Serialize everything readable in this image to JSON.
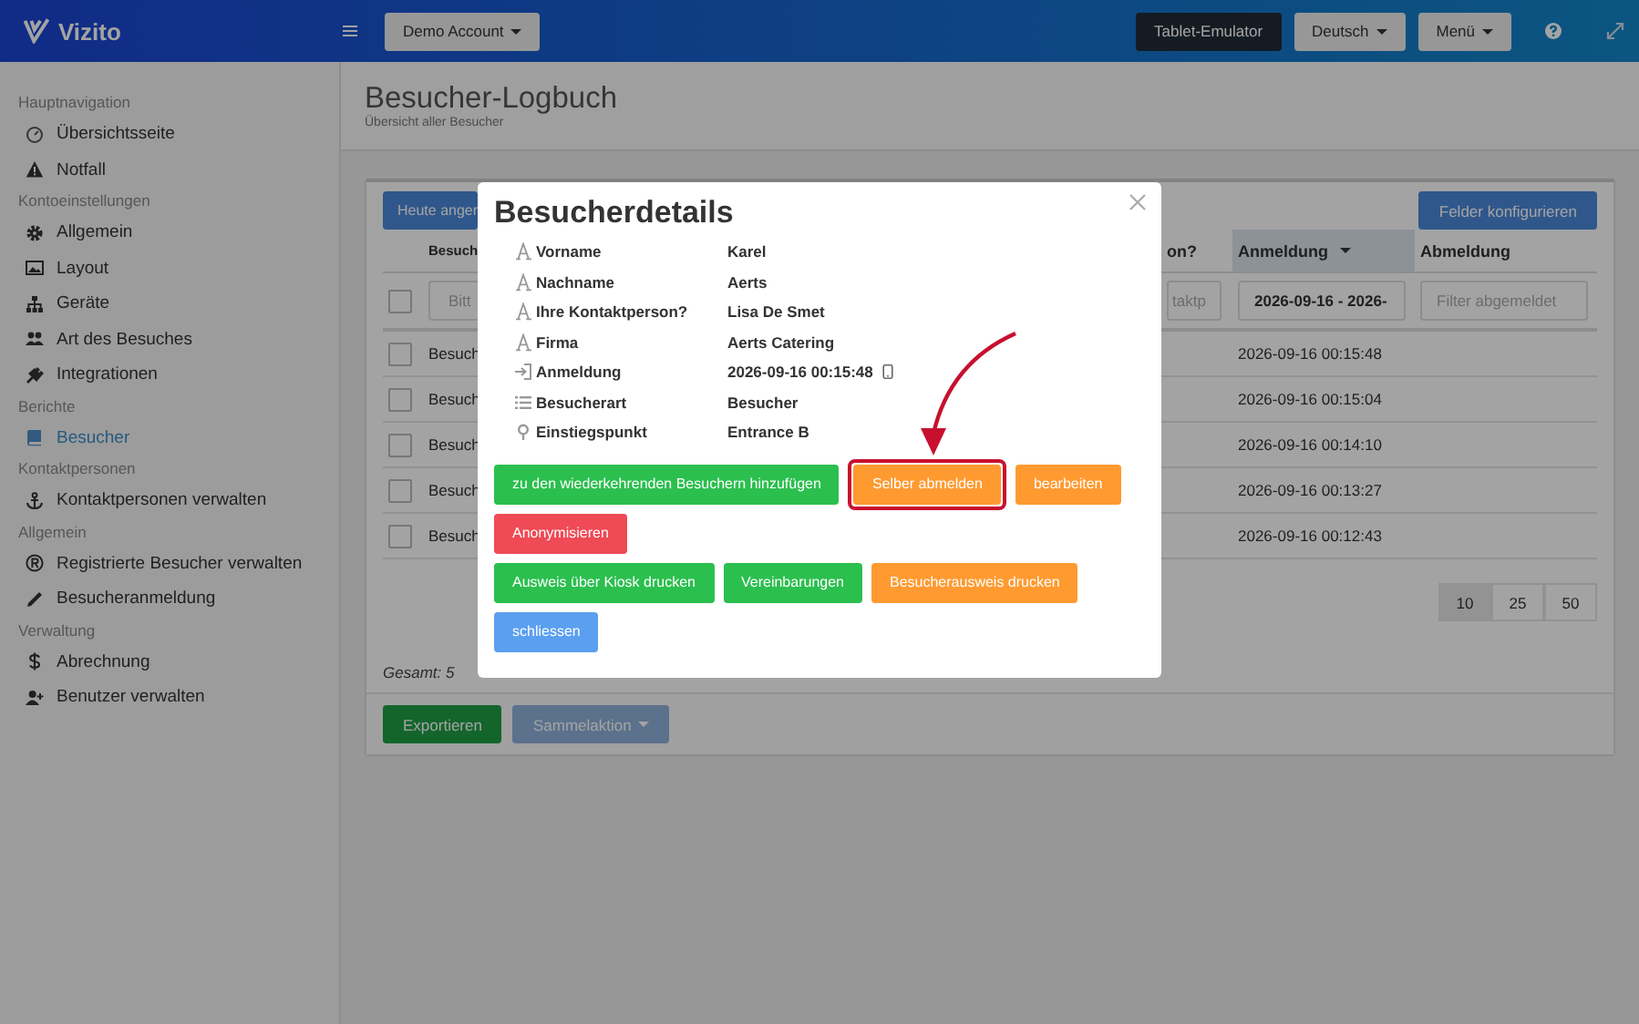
{
  "header": {
    "logo": "Vizito",
    "account": "Demo Account",
    "buttons": [
      {
        "label": "Tablet-Emulator",
        "kind": "dark"
      },
      {
        "label": "Deutsch",
        "kind": "dropdown"
      },
      {
        "label": "Menü",
        "kind": "dropdown"
      }
    ]
  },
  "sidebar": {
    "sections": [
      {
        "title": "Hauptnavigation",
        "items": [
          {
            "label": "Übersichtsseite",
            "selected": false
          },
          {
            "label": "Notfall",
            "selected": false
          }
        ]
      },
      {
        "title": "Kontoeinstellungen",
        "items": [
          {
            "label": "Allgemein",
            "selected": false
          },
          {
            "label": "Layout",
            "selected": false
          },
          {
            "label": "Geräte",
            "selected": false
          },
          {
            "label": "Art des Besuches",
            "selected": false
          },
          {
            "label": "Integrationen",
            "selected": false
          }
        ]
      },
      {
        "title": "Berichte",
        "items": [
          {
            "label": "Besucher",
            "selected": true
          }
        ]
      },
      {
        "title": "Kontaktpersonen",
        "items": [
          {
            "label": "Kontaktpersonen verwalten",
            "selected": false
          }
        ]
      },
      {
        "title": "Allgemein",
        "items": [
          {
            "label": "Registrierte Besucher verwalten",
            "selected": false
          },
          {
            "label": "Besucheranmeldung",
            "selected": false
          }
        ]
      },
      {
        "title": "Verwaltung",
        "items": [
          {
            "label": "Abrechnung",
            "selected": false
          },
          {
            "label": "Benutzer verwalten",
            "selected": false
          }
        ]
      }
    ]
  },
  "page": {
    "title": "Besucher-Logbuch",
    "subtitle": "Übersicht aller Besucher"
  },
  "table_panel": {
    "today_button": "Heute anger",
    "configure_button": "Felder konfigurieren",
    "columns": [
      {
        "label": "Besuch",
        "sorted": false
      },
      {
        "label": "on?",
        "sorted": false
      },
      {
        "label": "Anmeldung",
        "sorted": true
      },
      {
        "label": "Abmeldung",
        "sorted": false
      }
    ],
    "select_all_checked": false,
    "filters": [
      {
        "placeholder": "Bitt"
      },
      {
        "placeholder": "taktp"
      },
      {
        "value": "2026-09-16 - 2026-"
      },
      {
        "placeholder": "Filter abgemeldet"
      }
    ],
    "rows": [
      {
        "checked": false,
        "column_1": "Besuch",
        "anmeldung": "2026-09-16 00:15:48"
      },
      {
        "checked": false,
        "column_1": "Besuch",
        "anmeldung": "2026-09-16 00:15:04"
      },
      {
        "checked": false,
        "column_1": "Besuch",
        "anmeldung": "2026-09-16 00:14:10"
      },
      {
        "checked": false,
        "column_1": "Besuch",
        "anmeldung": "2026-09-16 00:13:27"
      },
      {
        "checked": false,
        "column_1": "Besuch",
        "anmeldung": "2026-09-16 00:12:43"
      }
    ],
    "page_sizes": [
      {
        "label": "10",
        "selected": true
      },
      {
        "label": "25",
        "selected": false
      },
      {
        "label": "50",
        "selected": false
      }
    ],
    "total": "Gesamt: 5",
    "export_button": "Exportieren",
    "bulk_button": "Sammelaktion"
  },
  "modal": {
    "title": "Besucherdetails",
    "details": [
      {
        "kind": "text",
        "label": "Vorname",
        "value": "Karel"
      },
      {
        "kind": "text",
        "label": "Nachname",
        "value": "Aerts"
      },
      {
        "kind": "text",
        "label": "Ihre Kontaktperson?",
        "value": "Lisa De Smet"
      },
      {
        "kind": "text",
        "label": "Firma",
        "value": "Aerts Catering"
      },
      {
        "kind": "checkin",
        "label": "Anmeldung",
        "value": "2026-09-16 00:15:48"
      },
      {
        "kind": "list",
        "label": "Besucherart",
        "value": "Besucher"
      },
      {
        "kind": "location",
        "label": "Einstiegspunkt",
        "value": "Entrance B"
      }
    ],
    "button_rows": [
      {
        "buttons": [
          {
            "label": "zu den wiederkehrenden Besuchern hinzufügen",
            "color": "#2bbf4e",
            "highlighted": false
          },
          {
            "label": "Selber abmelden",
            "color": "#ff9a30",
            "highlighted": true
          },
          {
            "label": "bearbeiten",
            "color": "#ff9a30",
            "highlighted": false
          }
        ]
      },
      {
        "buttons": [
          {
            "label": "Anonymisieren",
            "color": "#ef4a55",
            "highlighted": false
          }
        ]
      },
      {
        "buttons": [
          {
            "label": "Ausweis über Kiosk drucken",
            "color": "#2bbf4e",
            "highlighted": false
          },
          {
            "label": "Vereinbarungen",
            "color": "#2bbf4e",
            "highlighted": false
          },
          {
            "label": "Besucherausweis drucken",
            "color": "#ff9a30",
            "highlighted": false
          }
        ]
      },
      {
        "buttons": [
          {
            "label": "schliessen",
            "color": "#5b9ff0",
            "highlighted": false
          }
        ]
      }
    ]
  }
}
